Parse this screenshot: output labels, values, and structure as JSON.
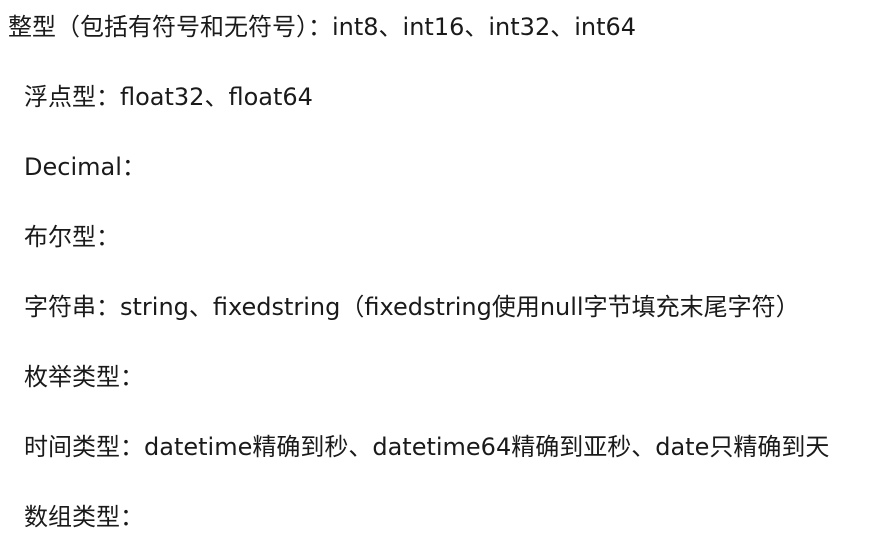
{
  "lines": [
    "整型（包括有符号和无符号）：int8、int16、int32、int64",
    "浮点型：float32、float64",
    "Decimal：",
    "布尔型：",
    "字符串：string、fixedstring（fixedstring使用null字节填充末尾字符）",
    "枚举类型：",
    "时间类型：datetime精确到秒、datetime64精确到亚秒、date只精确到天",
    "数组类型："
  ]
}
